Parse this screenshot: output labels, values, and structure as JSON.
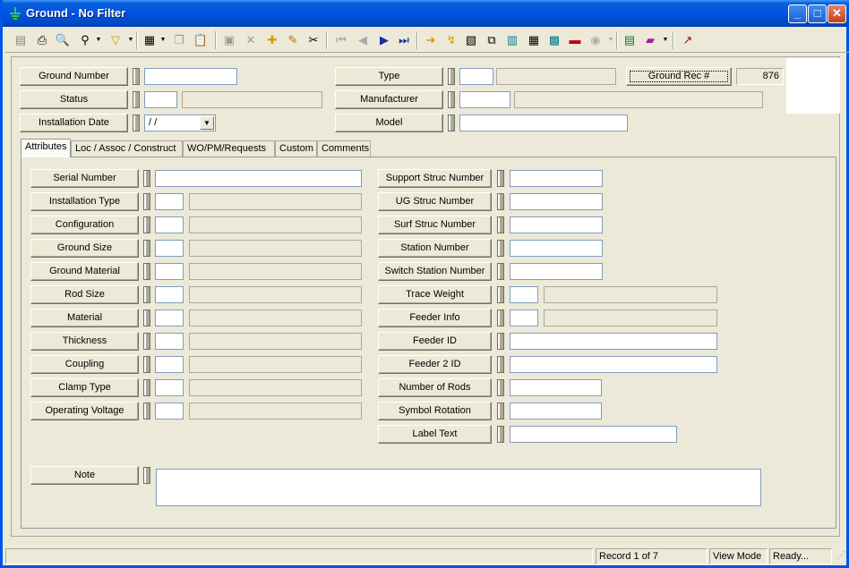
{
  "window": {
    "title": "Ground - No Filter",
    "min_glyph": "_",
    "max_glyph": "□",
    "close_glyph": "✕"
  },
  "toolbar": {
    "icons": [
      "print-preview-icon",
      "print-icon",
      "zoom-icon",
      "find-icon",
      "filter-icon",
      "report-icon",
      "copy-icon",
      "paste-icon",
      "cancel-edit-icon",
      "delete-icon",
      "new-record-icon",
      "edit-icon",
      "cut-icon",
      "first-record-icon",
      "previous-record-icon",
      "next-record-icon",
      "last-record-icon",
      "goto-icon",
      "refresh-icon",
      "map-icon",
      "relations-icon",
      "chart-icon",
      "calculator-icon",
      "layout-icon",
      "truck-icon",
      "search-globe-icon",
      "grid-icon",
      "book-icon",
      "exit-icon"
    ],
    "glyphs": {
      "print_preview": "▤",
      "print": "⎙",
      "zoom": "🔍",
      "find": "⚲",
      "filter": "▽",
      "report": "▦",
      "copy": "❐",
      "paste": "📋",
      "cancel": "▣",
      "delete": "✕",
      "new": "✚",
      "edit": "✎",
      "cut": "✂",
      "first": "⏮",
      "prev": "◀",
      "next": "▶",
      "last": "⏭",
      "goto": "➜",
      "refresh": "↯",
      "map": "▧",
      "relations": "⧉",
      "chart": "▥",
      "calc": "▦",
      "layout": "▩",
      "truck": "▬",
      "globe": "◉",
      "grid": "▤",
      "book": "▰",
      "exit": "↗",
      "drop": "▼"
    }
  },
  "header": {
    "ground_number": {
      "label": "Ground Number",
      "value": ""
    },
    "status": {
      "label": "Status",
      "code": "",
      "desc": ""
    },
    "installation_date": {
      "label": "Installation Date",
      "value": " /  /",
      "drop": "▼"
    },
    "type": {
      "label": "Type",
      "code": "",
      "desc": ""
    },
    "manufacturer": {
      "label": "Manufacturer",
      "code": "",
      "desc": ""
    },
    "model": {
      "label": "Model",
      "value": ""
    },
    "ground_rec": {
      "label": "Ground Rec #",
      "value": "876"
    }
  },
  "tabs": [
    "Attributes",
    "Loc / Assoc / Construct",
    "WO/PM/Requests",
    "Custom",
    "Comments"
  ],
  "left_fields": [
    {
      "label": "Serial Number"
    },
    {
      "label": "Installation Type"
    },
    {
      "label": "Configuration"
    },
    {
      "label": "Ground Size"
    },
    {
      "label": "Ground Material"
    },
    {
      "label": "Rod Size"
    },
    {
      "label": "Material"
    },
    {
      "label": "Thickness"
    },
    {
      "label": "Coupling"
    },
    {
      "label": "Clamp Type"
    },
    {
      "label": "Operating Voltage"
    }
  ],
  "right_fields": [
    {
      "label": "Support Struc Number"
    },
    {
      "label": "UG Struc Number"
    },
    {
      "label": "Surf Struc Number"
    },
    {
      "label": "Station Number"
    },
    {
      "label": "Switch Station Number"
    },
    {
      "label": "Trace Weight"
    },
    {
      "label": "Feeder Info"
    },
    {
      "label": "Feeder ID"
    },
    {
      "label": "Feeder 2 ID"
    },
    {
      "label": "Number of Rods"
    },
    {
      "label": "Symbol Rotation"
    },
    {
      "label": "Label Text"
    }
  ],
  "note": {
    "label": "Note",
    "value": ""
  },
  "status_bar": {
    "record": "Record 1 of 7",
    "mode": "View Mode",
    "state": "Ready..."
  }
}
